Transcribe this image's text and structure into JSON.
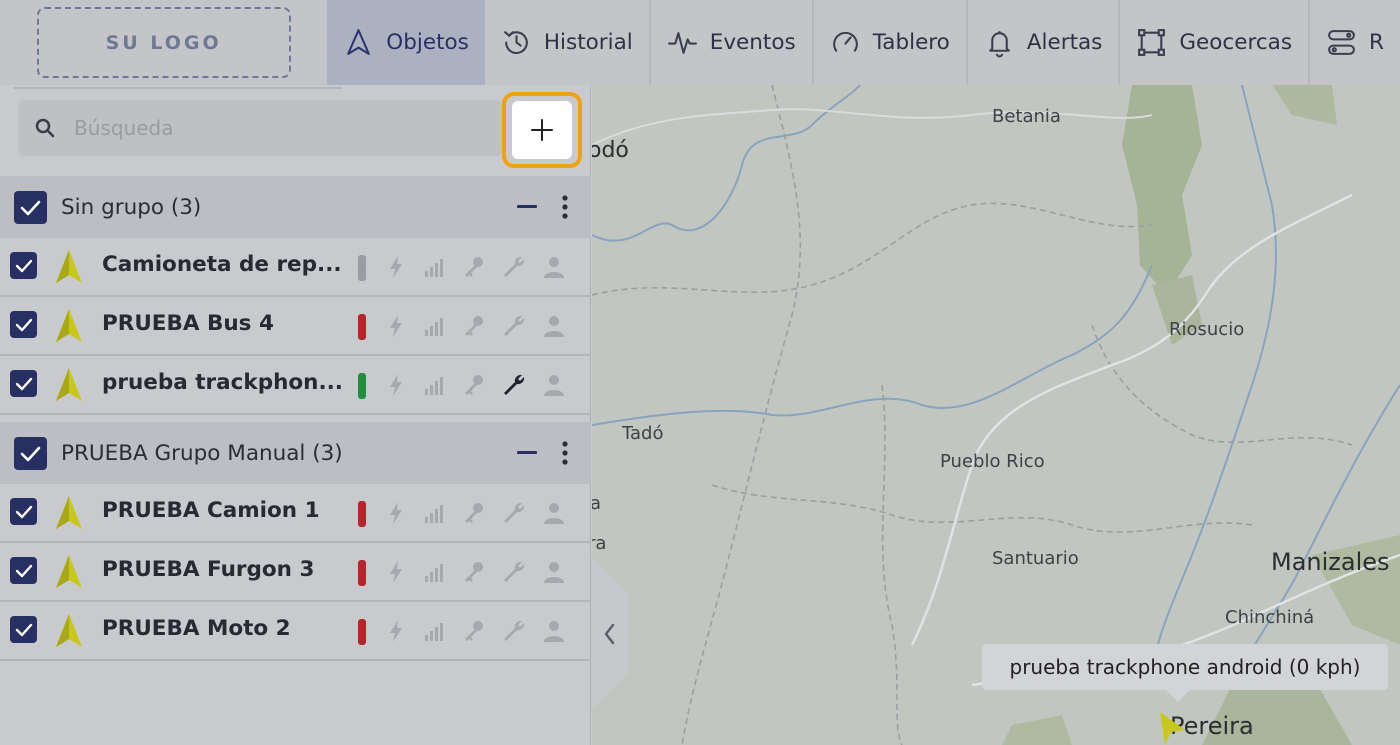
{
  "logo": {
    "text": "SU LOGO"
  },
  "nav": {
    "tabs": [
      {
        "label": "Objetos",
        "icon": "navigation-arrow-icon",
        "active": true
      },
      {
        "label": "Historial",
        "icon": "history-icon",
        "active": false
      },
      {
        "label": "Eventos",
        "icon": "pulse-icon",
        "active": false
      },
      {
        "label": "Tablero",
        "icon": "gauge-icon",
        "active": false
      },
      {
        "label": "Alertas",
        "icon": "bell-icon",
        "active": false
      },
      {
        "label": "Geocercas",
        "icon": "geofence-icon",
        "active": false
      },
      {
        "label": "R",
        "icon": "route-icon",
        "active": false
      }
    ]
  },
  "search": {
    "placeholder": "Búsqueda"
  },
  "groups": [
    {
      "name": "Sin grupo (3)",
      "items": [
        {
          "name": "Camioneta de rep...",
          "status_color": "#9a9ca3",
          "wrench_active": false
        },
        {
          "name": "PRUEBA Bus 4",
          "status_color": "#b3262b",
          "wrench_active": false
        },
        {
          "name": "prueba trackphon...",
          "status_color": "#1f8f3e",
          "wrench_active": true
        }
      ]
    },
    {
      "name": "PRUEBA Grupo Manual (3)",
      "items": [
        {
          "name": "PRUEBA Camion 1",
          "status_color": "#b3262b",
          "wrench_active": false
        },
        {
          "name": "PRUEBA Furgon 3",
          "status_color": "#b3262b",
          "wrench_active": false
        },
        {
          "name": "PRUEBA Moto 2",
          "status_color": "#b3262b",
          "wrench_active": false
        }
      ]
    }
  ],
  "map": {
    "places": [
      "odó",
      "Betania",
      "Riosucio",
      "Tadó",
      "Pueblo Rico",
      "Santuario",
      "Manizales",
      "Chinchiná",
      "Pereira",
      "a",
      "ra"
    ],
    "tooltip": "prueba trackphone android (0 kph)"
  },
  "colors": {
    "accent": "#283063",
    "highlight": "#f1a10f",
    "marker": "#c8c81c"
  }
}
